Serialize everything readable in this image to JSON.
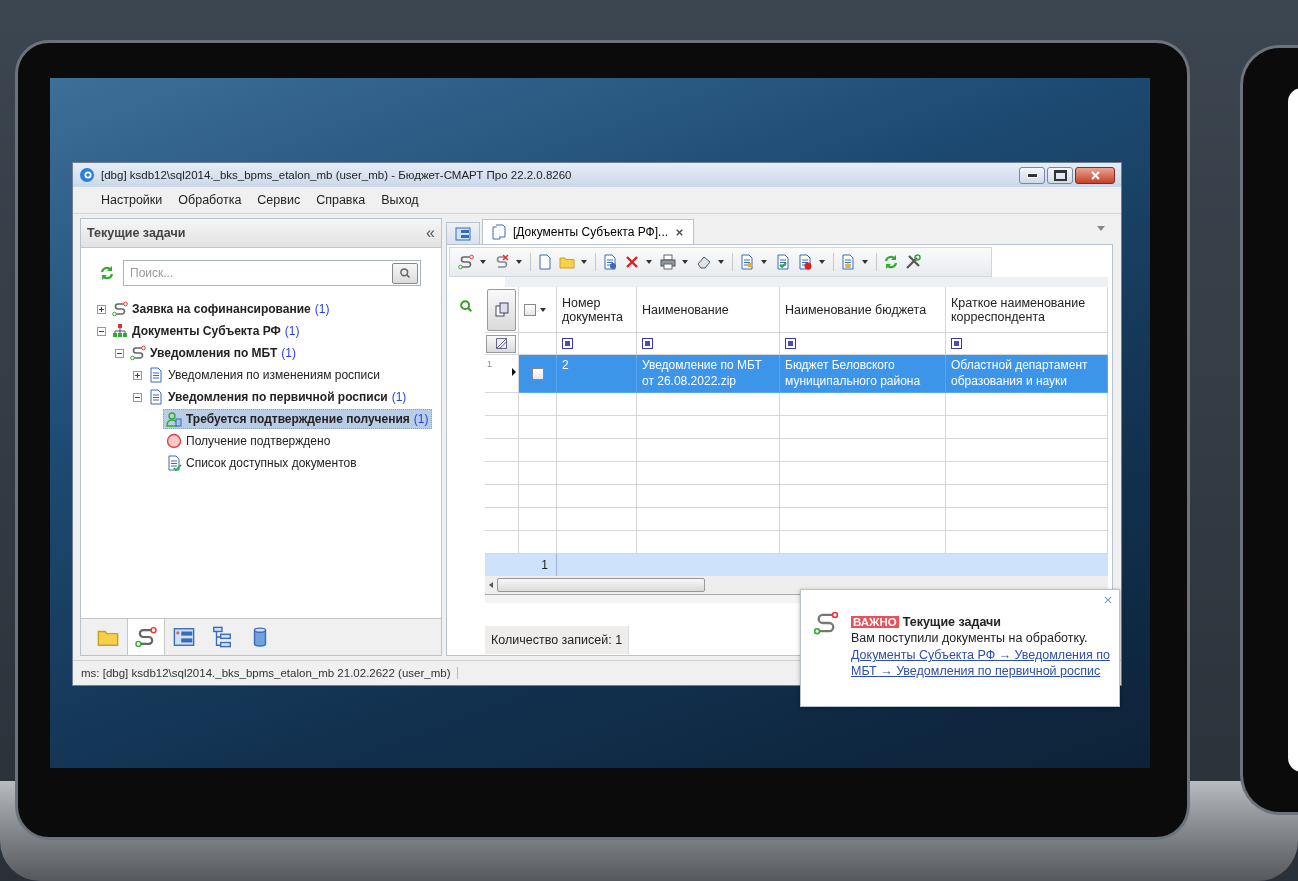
{
  "window": {
    "title": "[dbg] ksdb12\\sql2014._bks_bpms_etalon_mb (user_mb) - Бюджет-СМАРТ Про 22.2.0.8260"
  },
  "menu": [
    "Настройки",
    "Обработка",
    "Сервис",
    "Справка",
    "Выход"
  ],
  "left_panel": {
    "title": "Текущие задачи",
    "collapse": "«",
    "search": {
      "placeholder": "Поиск..."
    },
    "tree": [
      {
        "kind": "route",
        "label": "Заявка на софинансирование",
        "count": "(1)",
        "expanded": false,
        "selected": false
      },
      {
        "kind": "org",
        "label": "Документы Субъекта РФ",
        "count": "(1)",
        "expanded": true,
        "selected": false,
        "children": [
          {
            "kind": "route",
            "label": "Уведомления по МБТ",
            "count": "(1)",
            "expanded": true,
            "selected": false,
            "children": [
              {
                "kind": "doc",
                "label": "Уведомления по изменениям росписи",
                "expanded": false,
                "selected": false
              },
              {
                "kind": "doc",
                "label": "Уведомления по первичной росписи",
                "count": "(1)",
                "expanded": true,
                "selected": false,
                "children": [
                  {
                    "kind": "user",
                    "label": "Требуется подтверждение получения",
                    "count": "(1)",
                    "selected": true
                  },
                  {
                    "kind": "circle",
                    "label": "Получение подтверждено",
                    "selected": false
                  },
                  {
                    "kind": "checklist",
                    "label": "Список доступных документов",
                    "selected": false
                  }
                ]
              }
            ]
          }
        ]
      }
    ],
    "bottom_tabs": [
      {
        "kind": "folder",
        "selected": false
      },
      {
        "kind": "route",
        "selected": true
      },
      {
        "kind": "panel",
        "selected": false
      },
      {
        "kind": "tree",
        "selected": false
      },
      {
        "kind": "database",
        "selected": false
      }
    ]
  },
  "tabs": [
    {
      "kind": "icon",
      "selected": false
    },
    {
      "kind": "document",
      "label": "[Документы Субъекта РФ]...",
      "selected": true
    }
  ],
  "grid": {
    "select_all_checked": false,
    "columns": [
      "Номер документа",
      "Наименование",
      "Наименование бюджета",
      "Краткое наименование корреспондента"
    ],
    "rows": [
      {
        "number": "1",
        "checked": false,
        "selected": true,
        "cells": [
          "2",
          "Уведомление по МБТ от 26.08.2022.zip",
          "Бюджет Беловского муниципального района",
          "Областной департамент образования и науки"
        ]
      }
    ],
    "total": "1"
  },
  "record_count": "Количество записей: 1",
  "status_bar": "ms: [dbg] ksdb12\\sql2014._bks_bpms_etalon_mb 21.02.2622 (user_mb)",
  "notification": {
    "badge": "ВАЖНО",
    "title": "Текущие задачи",
    "message": "Вам поступили документы на обработку.",
    "link": "Документы Субъекта РФ → Уведомления по МБТ → Уведомления по первичной роспис"
  }
}
